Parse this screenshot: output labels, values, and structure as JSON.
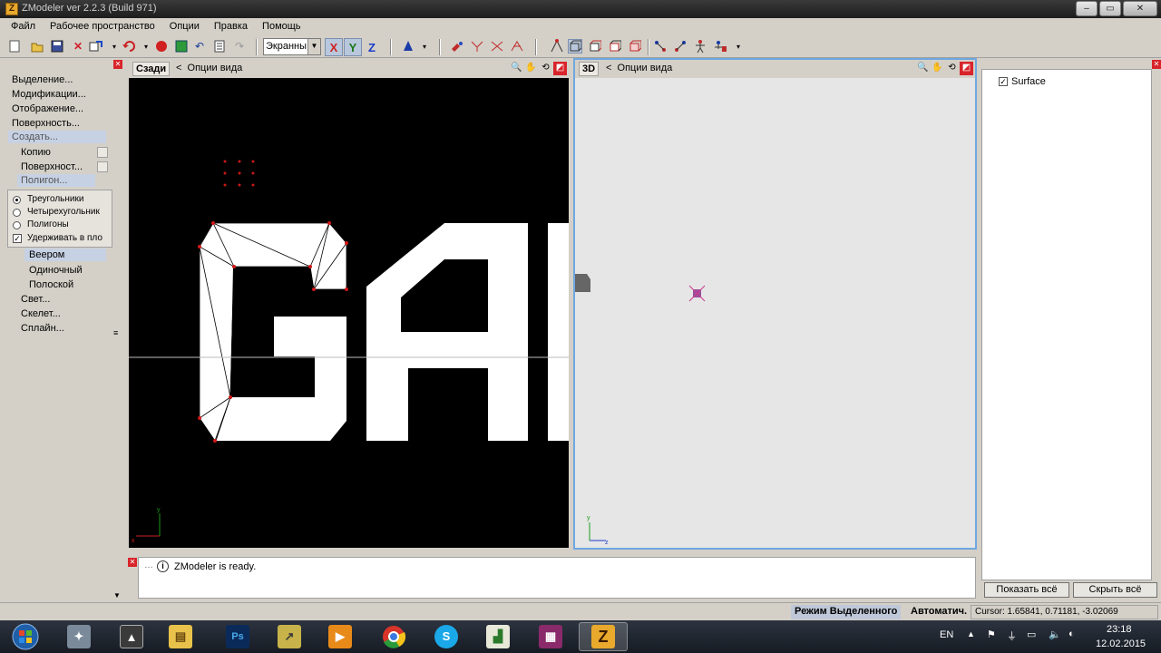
{
  "window": {
    "title": "ZModeler ver 2.2.3 (Build 971)",
    "minimize": "–",
    "maximize": "▭",
    "close": "✕"
  },
  "menu": [
    "Файл",
    "Рабочее пространство",
    "Опции",
    "Правка",
    "Помощь"
  ],
  "toolbar": {
    "view_select": "Экранны",
    "axes": [
      "X",
      "Y",
      "Z"
    ]
  },
  "left_panel": {
    "items": [
      "Выделение...",
      "Модификации...",
      "Отображение...",
      "Поверхность...",
      "Создать..."
    ],
    "create_sub": [
      "Копию",
      "Поверхност...",
      "Полигон..."
    ],
    "options": [
      {
        "label": "Треугольники",
        "checked": true
      },
      {
        "label": "Четырехугольник",
        "checked": false
      },
      {
        "label": "Полигоны",
        "checked": false
      }
    ],
    "keep_plane": {
      "label": "Удерживать в пло",
      "checked": true
    },
    "modes": [
      "Веером",
      "Одиночный",
      "Полоской"
    ],
    "more": [
      "Свет...",
      "Скелет...",
      "Сплайн..."
    ]
  },
  "viewport_left": {
    "label": "Сзади",
    "options": "Опции вида"
  },
  "viewport_right": {
    "label": "3D",
    "options": "Опции вида"
  },
  "right_panel": {
    "items": [
      {
        "label": "Surface",
        "checked": true
      }
    ],
    "show_all": "Показать всё",
    "hide_all": "Скрыть всё"
  },
  "log": {
    "message": "ZModeler is ready."
  },
  "status": {
    "mode": "Режим Выделенного",
    "auto": "Автоматич.",
    "cursor": "Cursor: 1.65841, 0.71181, -3.02069"
  },
  "taskbar": {
    "lang": "EN",
    "time": "23:18",
    "date": "12.02.2015",
    "apps": [
      "start",
      "app-star",
      "app-a",
      "explorer",
      "photoshop",
      "app-arrow",
      "media",
      "chrome",
      "skype",
      "app-chart",
      "winrar",
      "zmodeler"
    ]
  }
}
